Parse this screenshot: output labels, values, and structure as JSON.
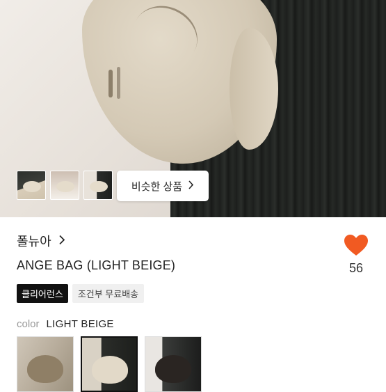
{
  "hero": {
    "similar_button_label": "비슷한 상품",
    "thumbnails": [
      "thumbnail-1",
      "thumbnail-2",
      "thumbnail-3"
    ]
  },
  "product": {
    "brand": "폴뉴아",
    "title": "ANGE BAG (LIGHT BEIGE)",
    "like_count": "56",
    "badges": {
      "clearance": "클리어런스",
      "shipping": "조건부 무료배송"
    }
  },
  "color": {
    "label": "color",
    "value": "LIGHT BEIGE",
    "selected_index": 1
  },
  "colors": {
    "heart": "#f15a22",
    "badge_dark": "#111111"
  }
}
